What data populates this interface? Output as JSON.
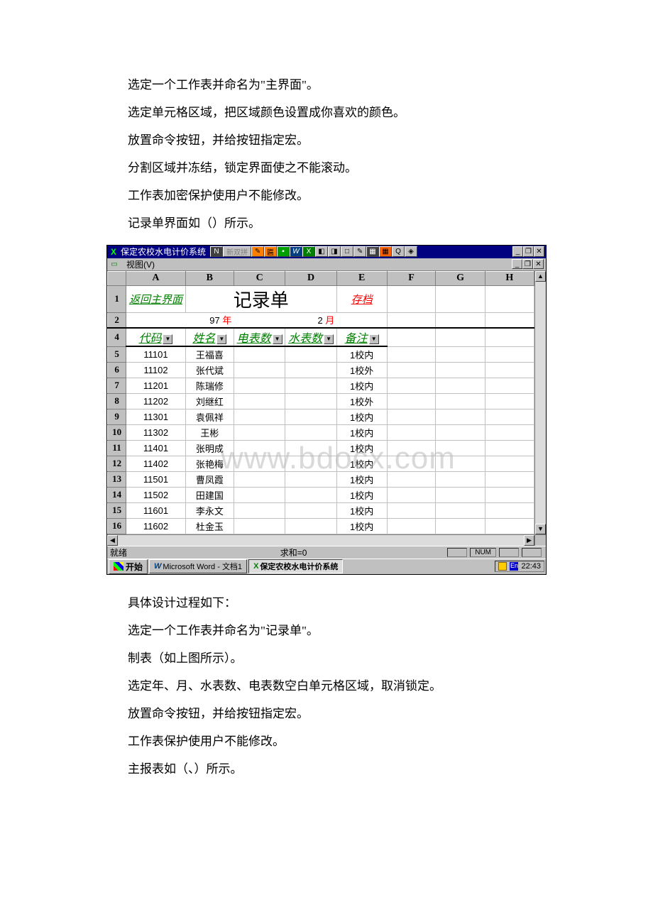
{
  "intro": {
    "l1": "选定一个工作表并命名为\"主界面\"。",
    "l2": "选定单元格区域，把区域颜色设置成你喜欢的颜色。",
    "l3": "放置命令按钮，并给按钮指定宏。",
    "l4": "分割区域并冻结，锁定界面使之不能滚动。",
    "l5": "工作表加密保护使用户不能修改。",
    "l6": "记录单界面如（）所示。"
  },
  "titlebar": {
    "app_title": "保定农校水电计价系统",
    "ime_label": "新双拼"
  },
  "menubar": {
    "view": "视图(V)"
  },
  "columns": [
    "A",
    "B",
    "C",
    "D",
    "E",
    "F",
    "G",
    "H"
  ],
  "rows_visible": [
    "1",
    "2",
    "4",
    "5",
    "6",
    "7",
    "8",
    "9",
    "10",
    "11",
    "12",
    "13",
    "14",
    "15",
    "16"
  ],
  "sheet": {
    "return_btn": "返回主界面",
    "title": "记录单",
    "archive_btn": "存档",
    "year_value": "97",
    "year_suffix": "年",
    "month_value": "2",
    "month_suffix": "月",
    "headers": {
      "code": "代码",
      "name": "姓名",
      "elec": "电表数",
      "water": "水表数",
      "note": "备注"
    },
    "data": [
      {
        "code": "11101",
        "name": "王福喜",
        "note": "1校内"
      },
      {
        "code": "11102",
        "name": "张代斌",
        "note": "1校外"
      },
      {
        "code": "11201",
        "name": "陈瑞修",
        "note": "1校内"
      },
      {
        "code": "11202",
        "name": "刘继红",
        "note": "1校外"
      },
      {
        "code": "11301",
        "name": "袁佩祥",
        "note": "1校内"
      },
      {
        "code": "11302",
        "name": "王彬",
        "note": "1校内"
      },
      {
        "code": "11401",
        "name": "张明成",
        "note": "1校内"
      },
      {
        "code": "11402",
        "name": "张艳梅",
        "note": "1校内"
      },
      {
        "code": "11501",
        "name": "曹凤霞",
        "note": "1校内"
      },
      {
        "code": "11502",
        "name": "田建国",
        "note": "1校内"
      },
      {
        "code": "11601",
        "name": "李永文",
        "note": "1校内"
      },
      {
        "code": "11602",
        "name": "杜金玉",
        "note": "1校内"
      }
    ]
  },
  "statusbar": {
    "ready": "就绪",
    "sum": "求和=0",
    "num": "NUM"
  },
  "taskbar": {
    "start": "开始",
    "task1": "Microsoft Word - 文档1",
    "task2": "保定农校水电计价系统",
    "ime": "En",
    "clock": "22:43"
  },
  "watermark": "www.bdocx.com",
  "outro": {
    "l1": "具体设计过程如下：",
    "l2": "选定一个工作表并命名为\"记录单\"。",
    "l3": "制表（如上图所示）。",
    "l4": "选定年、月、水表数、电表数空白单元格区域，取消锁定。",
    "l5": "放置命令按钮，并给按钮指定宏。",
    "l6": "工作表保护使用户不能修改。",
    "l7": "主报表如（、）所示。"
  }
}
